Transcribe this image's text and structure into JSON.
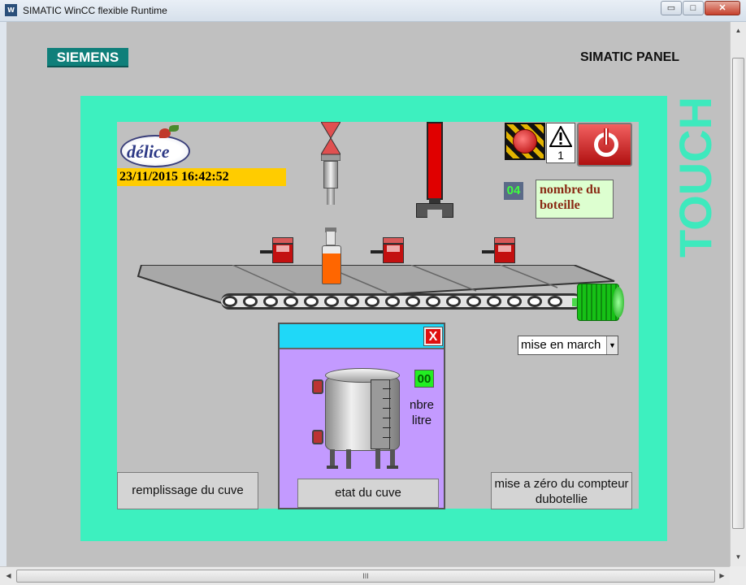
{
  "window": {
    "title": "SIMATIC WinCC flexible Runtime",
    "icon": "wincc-app-icon",
    "minimize_glyph": "▭",
    "maximize_glyph": "□",
    "close_glyph": "✕"
  },
  "panel": {
    "brand": "SIEMENS",
    "title": "SIMATIC PANEL",
    "side_label": "TOUCH"
  },
  "screen": {
    "logo_text": "délice",
    "datetime": "23/11/2015 16:42:52",
    "alarm_button_label": "ALARM",
    "warning_count": "1",
    "bottle_counter": "04",
    "bottle_counter_label": "nombre du boteille",
    "mode_select_value": "mise en march",
    "fill_button": "remplissage du cuve",
    "reset_button": "mise a zéro du compteur dubotellie"
  },
  "popup": {
    "close_label": "X",
    "level_value": "00",
    "level_label": "nbre litre",
    "state_button": "etat du cuve"
  },
  "colors": {
    "bezel": "#3df0bf",
    "datetime_bg": "#ffcc00",
    "popup_bg": "#c39aff",
    "popup_title_bg": "#1fd8f8",
    "piston": "#e00000",
    "motor": "#16c116"
  },
  "scrollbar": {
    "grip": "III"
  }
}
